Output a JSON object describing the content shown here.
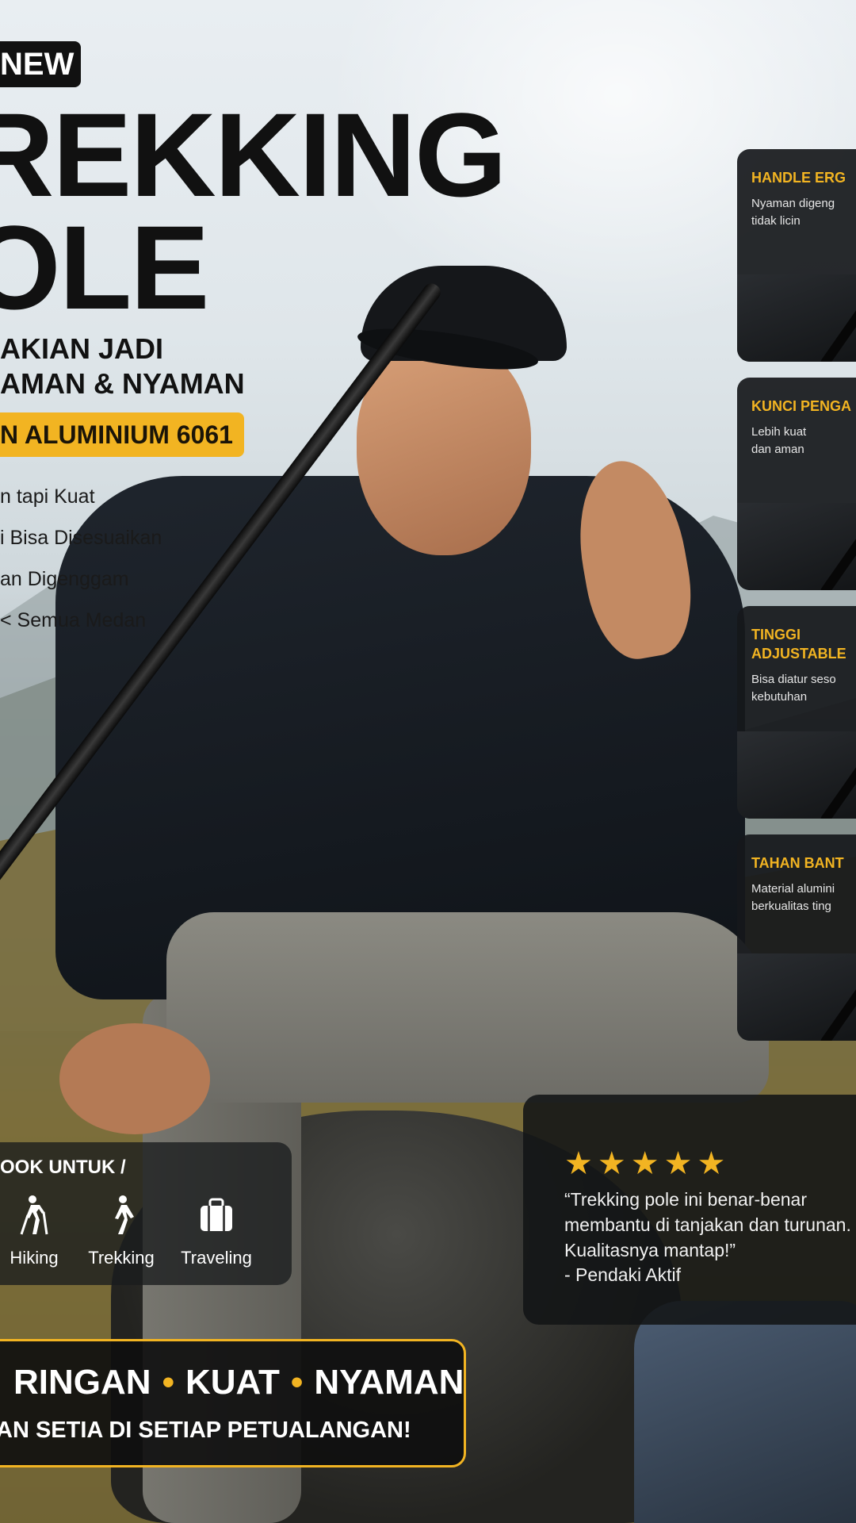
{
  "header": {
    "badge": "NEW",
    "title_line1": "REKKING",
    "title_line2": "OLE",
    "subtitle_line1": "AKIAN JADI",
    "subtitle_line2": "AMAN & NYAMAN",
    "material_badge": "N ALUMINIUM 6061"
  },
  "bullets": [
    "n tapi Kuat",
    "i Bisa Disesuaikan",
    "an Digenggam",
    "< Semua Medan"
  ],
  "features": [
    {
      "title": "HANDLE ERG",
      "desc": "Nyaman digeng\ntidak licin"
    },
    {
      "title": "KUNCI PENGA",
      "desc": "Lebih kuat\ndan aman"
    },
    {
      "title": "TINGGI\nADJUSTABLE",
      "desc": "Bisa diatur seso\nkebutuhan"
    },
    {
      "title": "TAHAN BANT",
      "desc": "Material alumini\nberkualitas ting"
    }
  ],
  "cocok": {
    "title": "OOK UNTUK /",
    "activities": [
      {
        "label": "Hiking",
        "icon": "hiking-icon"
      },
      {
        "label": "Trekking",
        "icon": "walking-icon"
      },
      {
        "label": "Traveling",
        "icon": "suitcase-icon"
      }
    ]
  },
  "review": {
    "stars": "★★★★★",
    "rating": 5,
    "quote": "“Trekking pole ini benar-benar membantu di tanjakan dan turunan. Kualitasnya mantap!”",
    "author": "- Pendaki Aktif"
  },
  "banner": {
    "w1": "RINGAN",
    "w2": "KUAT",
    "w3": "NYAMAN",
    "dot": "•",
    "tagline": "AN SETIA DI SETIAP PETUALANGAN!"
  },
  "colors": {
    "accent": "#f2b422",
    "panel": "#16181b",
    "title": "#111111"
  }
}
